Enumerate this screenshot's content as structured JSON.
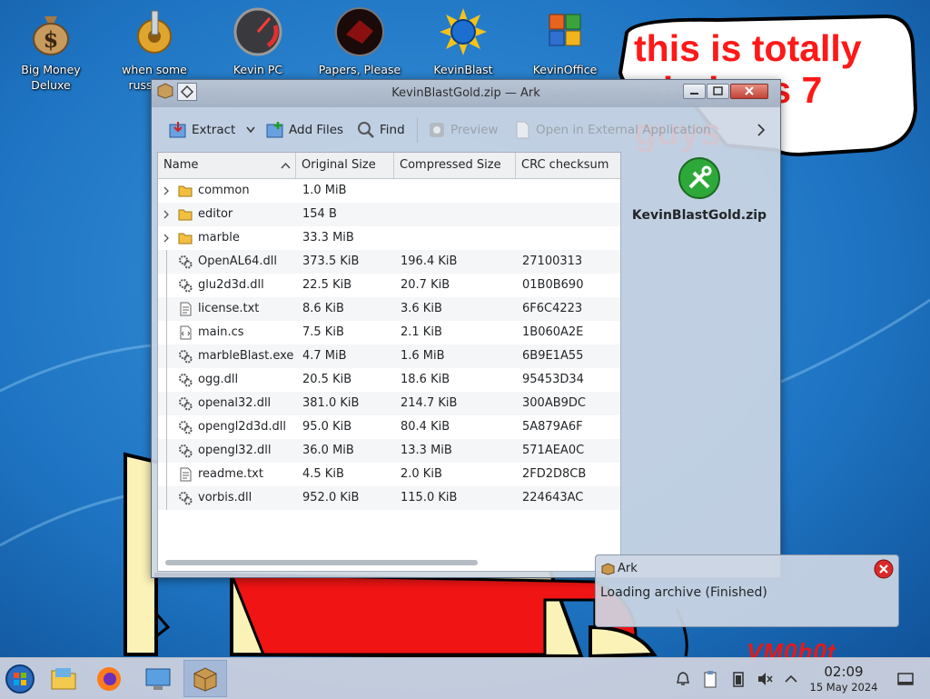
{
  "desktop": {
    "icons": [
      {
        "label": "Big Money\nDeluxe",
        "icon": "money-bag-icon"
      },
      {
        "label": "when some\nrussian...",
        "icon": "gear-wrench-icon"
      },
      {
        "label": "Kevin PC\nOptimizer Ho...",
        "icon": "speedometer-icon"
      },
      {
        "label": "Papers, Please",
        "icon": "papers-please-icon"
      },
      {
        "label": "KevinBlast",
        "icon": "marble-blast-icon"
      },
      {
        "label": "KevinOffice\n2009",
        "icon": "office-icon"
      }
    ],
    "bubble_text": "this is totally\nwindows 7 guys",
    "watermark_text": "VM0h0t"
  },
  "window": {
    "title": "KevinBlastGold.zip — Ark",
    "toolbar": {
      "extract": "Extract",
      "add_files": "Add Files",
      "find": "Find",
      "preview": "Preview",
      "open_external": "Open in External Application"
    },
    "columns": [
      "Name",
      "Original Size",
      "Compressed Size",
      "CRC checksum"
    ],
    "rows": [
      {
        "name": "common",
        "original": "1.0 MiB",
        "compressed": "",
        "crc": "",
        "type": "folder"
      },
      {
        "name": "editor",
        "original": "154 B",
        "compressed": "",
        "crc": "",
        "type": "folder"
      },
      {
        "name": "marble",
        "original": "33.3 MiB",
        "compressed": "",
        "crc": "",
        "type": "folder"
      },
      {
        "name": "OpenAL64.dll",
        "original": "373.5 KiB",
        "compressed": "196.4 KiB",
        "crc": "27100313",
        "type": "dll"
      },
      {
        "name": "glu2d3d.dll",
        "original": "22.5 KiB",
        "compressed": "20.7 KiB",
        "crc": "01B0B690",
        "type": "dll"
      },
      {
        "name": "license.txt",
        "original": "8.6 KiB",
        "compressed": "3.6 KiB",
        "crc": "6F6C4223",
        "type": "text"
      },
      {
        "name": "main.cs",
        "original": "7.5 KiB",
        "compressed": "2.1 KiB",
        "crc": "1B060A2E",
        "type": "script"
      },
      {
        "name": "marbleBlast.exe",
        "original": "4.7 MiB",
        "compressed": "1.6 MiB",
        "crc": "6B9E1A55",
        "type": "dll"
      },
      {
        "name": "ogg.dll",
        "original": "20.5 KiB",
        "compressed": "18.6 KiB",
        "crc": "95453D34",
        "type": "dll"
      },
      {
        "name": "openal32.dll",
        "original": "381.0 KiB",
        "compressed": "214.7 KiB",
        "crc": "300AB9DC",
        "type": "dll"
      },
      {
        "name": "opengl2d3d.dll",
        "original": "95.0 KiB",
        "compressed": "80.4 KiB",
        "crc": "5A879A6F",
        "type": "dll"
      },
      {
        "name": "opengl32.dll",
        "original": "36.0 MiB",
        "compressed": "13.3 MiB",
        "crc": "571AEA0C",
        "type": "dll"
      },
      {
        "name": "readme.txt",
        "original": "4.5 KiB",
        "compressed": "2.0 KiB",
        "crc": "2FD2D8CB",
        "type": "text"
      },
      {
        "name": "vorbis.dll",
        "original": "952.0 KiB",
        "compressed": "115.0 KiB",
        "crc": "224643AC",
        "type": "dll"
      }
    ],
    "side_panel": {
      "filename": "KevinBlastGold.zip"
    }
  },
  "notification": {
    "app": "Ark",
    "message": "Loading archive (Finished)"
  },
  "taskbar": {
    "clock_time": "02:09",
    "clock_date": "15 May 2024"
  },
  "colors": {
    "desktop_blue": "#1f6fb8",
    "bubble_text": "#ff1818",
    "window_bg": "#cdd7e4"
  }
}
